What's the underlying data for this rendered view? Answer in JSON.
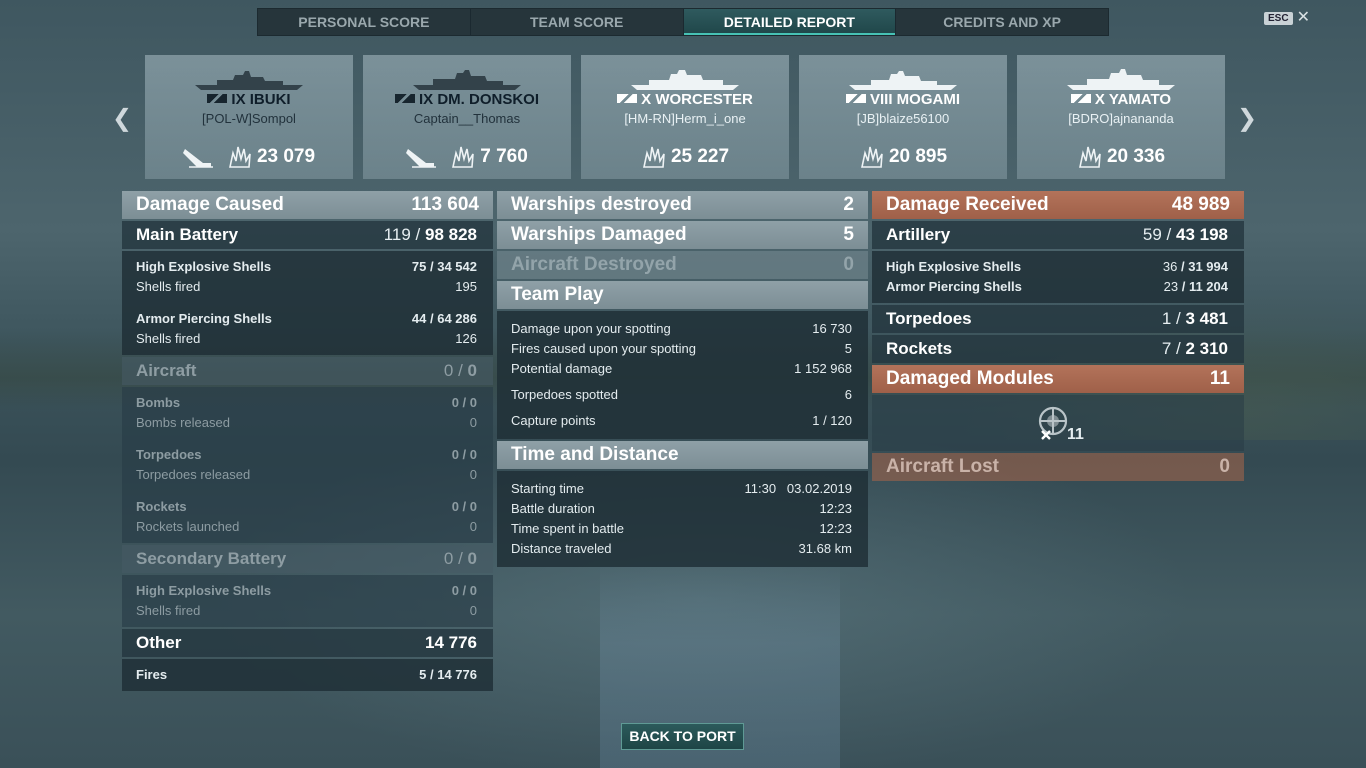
{
  "tabs": [
    "PERSONAL SCORE",
    "TEAM SCORE",
    "DETAILED REPORT",
    "CREDITS AND XP"
  ],
  "esc_label": "ESC",
  "ships": [
    {
      "name": "IX IBUKI",
      "player": "[POL-W]Sompol",
      "damage": "23 079",
      "sunk": true,
      "light": false
    },
    {
      "name": "IX DM. DONSKOI",
      "player": "Captain__Thomas",
      "damage": "7 760",
      "sunk": true,
      "light": false
    },
    {
      "name": "X WORCESTER",
      "player": "[HM-RN]Herm_i_one",
      "damage": "25 227",
      "sunk": false,
      "light": true
    },
    {
      "name": "VIII MOGAMI",
      "player": "[JB]blaize56100",
      "damage": "20 895",
      "sunk": false,
      "light": true
    },
    {
      "name": "X YAMATO",
      "player": "[BDRO]ajnananda",
      "damage": "20 336",
      "sunk": false,
      "light": true
    }
  ],
  "caused": {
    "title": "Damage Caused",
    "total": "113 604",
    "main_battery": {
      "label": "Main Battery",
      "hits": "119",
      "dmg": "98 828"
    },
    "he": {
      "label": "High Explosive Shells",
      "hits": "75",
      "dmg": "34 542",
      "fired_label": "Shells fired",
      "fired": "195"
    },
    "ap": {
      "label": "Armor Piercing Shells",
      "hits": "44",
      "dmg": "64 286",
      "fired_label": "Shells fired",
      "fired": "126"
    },
    "aircraft": {
      "label": "Aircraft",
      "hits": "0",
      "dmg": "0"
    },
    "bombs": {
      "label": "Bombs",
      "hits": "0",
      "dmg": "0",
      "sub_label": "Bombs released",
      "sub": "0"
    },
    "torps": {
      "label": "Torpedoes",
      "hits": "0",
      "dmg": "0",
      "sub_label": "Torpedoes released",
      "sub": "0"
    },
    "rockets": {
      "label": "Rockets",
      "hits": "0",
      "dmg": "0",
      "sub_label": "Rockets launched",
      "sub": "0"
    },
    "secondary": {
      "label": "Secondary Battery",
      "hits": "0",
      "dmg": "0"
    },
    "sec_he": {
      "label": "High Explosive Shells",
      "hits": "0",
      "dmg": "0",
      "sub_label": "Shells fired",
      "sub": "0"
    },
    "other": {
      "label": "Other",
      "total": "14 776"
    },
    "fires": {
      "label": "Fires",
      "hits": "5",
      "dmg": "14 776"
    }
  },
  "middle": {
    "destroyed": {
      "label": "Warships destroyed",
      "value": "2"
    },
    "damaged": {
      "label": "Warships Damaged",
      "value": "5"
    },
    "aircraft": {
      "label": "Aircraft Destroyed",
      "value": "0"
    },
    "team_play": {
      "label": "Team Play",
      "rows": [
        {
          "label": "Damage upon your spotting",
          "value": "16 730"
        },
        {
          "label": "Fires caused upon your spotting",
          "value": "5"
        },
        {
          "label": "Potential damage",
          "value": "1 152 968"
        },
        {
          "label": "Torpedoes spotted",
          "value": "6"
        },
        {
          "label": "Capture points",
          "value": "1 / 120"
        }
      ]
    },
    "time": {
      "label": "Time and Distance",
      "rows": [
        {
          "label": "Starting time",
          "value": "11:30   03.02.2019"
        },
        {
          "label": "Battle duration",
          "value": "12:23"
        },
        {
          "label": "Time spent in battle",
          "value": "12:23"
        },
        {
          "label": "Distance traveled",
          "value": "31.68 km"
        }
      ]
    }
  },
  "received": {
    "title": "Damage Received",
    "total": "48 989",
    "artillery": {
      "label": "Artillery",
      "hits": "59",
      "dmg": "43 198"
    },
    "he": {
      "label": "High Explosive Shells",
      "hits": "36",
      "dmg": "31 994"
    },
    "ap": {
      "label": "Armor Piercing Shells",
      "hits": "23",
      "dmg": "11 204"
    },
    "torps": {
      "label": "Torpedoes",
      "hits": "1",
      "dmg": "3 481"
    },
    "rockets": {
      "label": "Rockets",
      "hits": "7",
      "dmg": "2 310"
    },
    "modules": {
      "label": "Damaged Modules",
      "value": "11",
      "icon_count": "11"
    },
    "aircraft_lost": {
      "label": "Aircraft Lost",
      "value": "0"
    }
  },
  "back_button": "BACK TO PORT",
  "colors": {
    "accent": "#47c2b5",
    "orange": "#a9684f",
    "header": "#8699a0"
  }
}
